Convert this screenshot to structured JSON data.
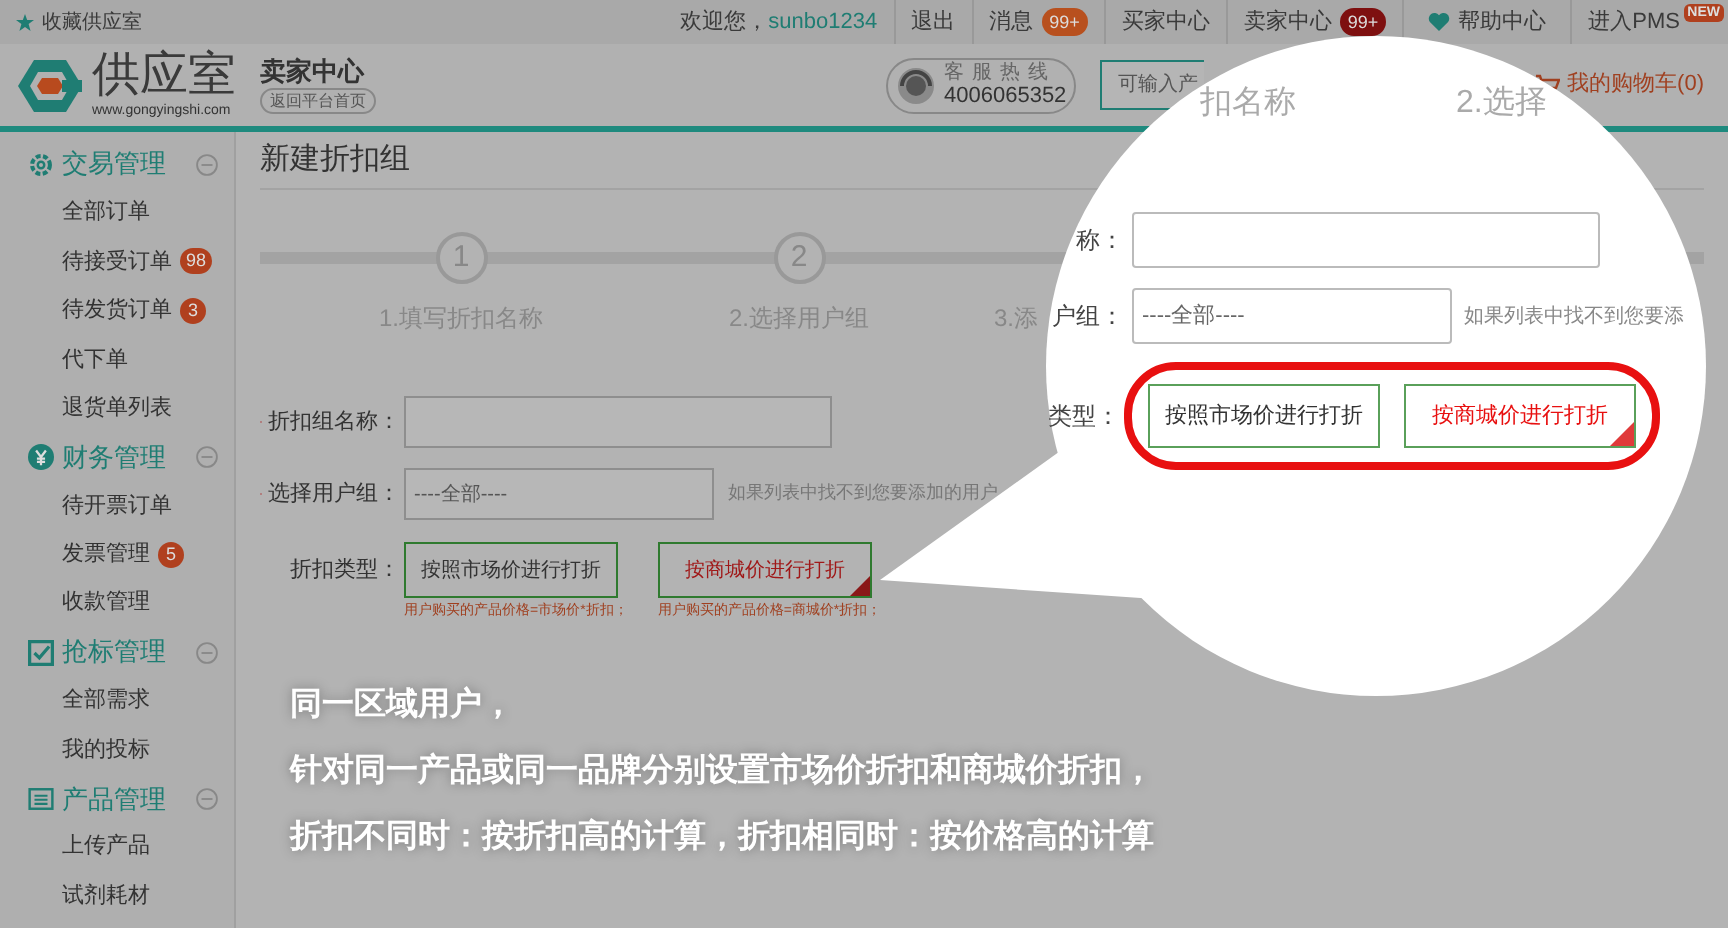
{
  "top_bar": {
    "bookmark": "收藏供应室",
    "greeting": "欢迎您，",
    "username": "sunbo1234",
    "links": [
      {
        "kind": "text",
        "label": "退出"
      },
      {
        "kind": "badge",
        "label": "消息",
        "badge": "99+",
        "color": "#b8501e"
      },
      {
        "kind": "text",
        "label": "买家中心"
      },
      {
        "kind": "badge",
        "label": "卖家中心",
        "badge": "99+",
        "color": "#7e1010"
      },
      {
        "kind": "heart",
        "label": "帮助中心"
      },
      {
        "kind": "new",
        "label": "进入PMS",
        "badge": "NEW"
      }
    ]
  },
  "header": {
    "logo": {
      "name": "供应室",
      "url": "www.gongyingshi.com"
    },
    "section_title": "卖家中心",
    "back_link": "返回平台首页",
    "hotline": {
      "label": "客服热线",
      "number": "4006065352"
    },
    "search": {
      "placeholder": "可输入产"
    },
    "cart": "我的购物车(0)"
  },
  "sidebar": {
    "sections": [
      {
        "title": "交易管理",
        "kind": "gear",
        "expanded": true,
        "items": [
          {
            "label": "全部订单"
          },
          {
            "label": "待接受订单",
            "badge": "98"
          },
          {
            "label": "待发货订单",
            "badge": "3"
          },
          {
            "label": "代下单"
          },
          {
            "label": "退货单列表"
          }
        ]
      },
      {
        "title": "财务管理",
        "kind": "yen",
        "expanded": true,
        "items": [
          {
            "label": "待开票订单"
          },
          {
            "label": "发票管理",
            "badge": "5"
          },
          {
            "label": "收款管理"
          }
        ]
      },
      {
        "title": "抢标管理",
        "kind": "check",
        "expanded": true,
        "items": [
          {
            "label": "全部需求"
          },
          {
            "label": "我的投标"
          }
        ]
      },
      {
        "title": "产品管理",
        "kind": "list",
        "expanded": true,
        "items": [
          {
            "label": "上传产品"
          },
          {
            "label": "试剂耗材"
          }
        ]
      }
    ]
  },
  "content": {
    "title": "新建折扣组",
    "steps": [
      {
        "number": "1",
        "label": "1.填写折扣名称"
      },
      {
        "number": "2",
        "label": "2.选择用户组"
      },
      {
        "label": "3.添"
      }
    ],
    "name_field": {
      "label": "折扣组名称：",
      "required": true
    },
    "group_field": {
      "label": "选择用户组：",
      "required": true,
      "value": "----全部----",
      "hint": "如果列表中找不到您要添加的用户"
    },
    "type_field": {
      "label": "折扣类型：",
      "options": [
        {
          "label": "按照市场价进行打折",
          "note": "用户购买的产品价格=市场价*折扣；",
          "selected": false
        },
        {
          "label": "按商城价进行打折",
          "note": "用户购买的产品价格=商城价*折扣；",
          "selected": true
        }
      ]
    }
  },
  "magnifier": {
    "top_texts": [
      "扣名称",
      "2.选择"
    ],
    "name_label": "称：",
    "group_label": "户组：",
    "group_value": "----全部----",
    "hint": "如果列表中找不到您要添",
    "type_label": "类型：",
    "options": [
      {
        "label": "按照市场价进行打折",
        "selected": false
      },
      {
        "label": "按商城价进行打折",
        "selected": true
      }
    ]
  },
  "caption": {
    "lines": [
      "同一区域用户，",
      "针对同一产品或同一品牌分别设置市场价折扣和商城价折扣，",
      "折扣不同时：按折扣高的计算，折扣相同时：按价格高的计算"
    ]
  }
}
